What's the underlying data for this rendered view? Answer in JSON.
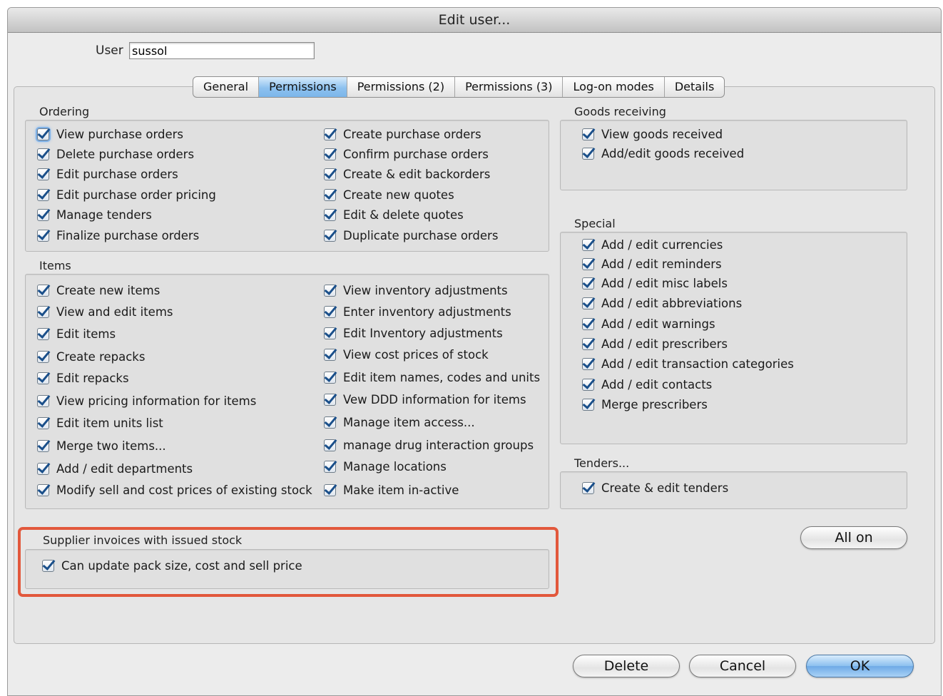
{
  "window": {
    "title": "Edit user..."
  },
  "user": {
    "label": "User",
    "value": "sussol"
  },
  "tabs": [
    {
      "label": "General",
      "active": false
    },
    {
      "label": "Permissions",
      "active": true
    },
    {
      "label": "Permissions (2)",
      "active": false
    },
    {
      "label": "Permissions (3)",
      "active": false
    },
    {
      "label": "Log-on modes",
      "active": false
    },
    {
      "label": "Details",
      "active": false
    }
  ],
  "ordering": {
    "title": "Ordering",
    "left": [
      "View purchase orders",
      "Delete purchase orders",
      "Edit purchase orders",
      "Edit purchase order pricing",
      "Manage tenders",
      "Finalize purchase orders"
    ],
    "right": [
      "Create purchase orders",
      "Confirm purchase orders",
      "Create & edit backorders",
      "Create new quotes",
      "Edit & delete quotes",
      "Duplicate purchase orders"
    ]
  },
  "items": {
    "title": "Items",
    "left": [
      "Create new items",
      "View and edit items",
      "Edit items",
      "Create repacks",
      "Edit repacks",
      "View pricing information for items",
      "Edit item units list",
      "Merge two items...",
      "Add / edit departments",
      "Modify sell and cost prices of existing stock"
    ],
    "right": [
      "View inventory adjustments",
      "Enter inventory adjustments",
      "Edit Inventory adjustments",
      "View cost prices of stock",
      "Edit item names, codes and units",
      "Vew DDD information for items",
      "Manage item access...",
      "manage drug interaction groups",
      "Manage locations",
      "Make item in-active"
    ]
  },
  "supplier": {
    "title": "Supplier invoices with issued stock",
    "items": [
      "Can update pack size, cost and sell price"
    ]
  },
  "goods": {
    "title": "Goods receiving",
    "items": [
      "View goods received",
      "Add/edit goods received"
    ]
  },
  "special": {
    "title": "Special",
    "items": [
      "Add / edit currencies",
      "Add / edit reminders",
      "Add / edit misc labels",
      "Add / edit abbreviations",
      "Add / edit warnings",
      "Add / edit prescribers",
      "Add / edit transaction categories",
      "Add / edit contacts",
      "Merge prescribers"
    ]
  },
  "tenders": {
    "title": "Tenders...",
    "items": [
      "Create & edit tenders"
    ]
  },
  "buttons": {
    "all_on": "All on",
    "delete": "Delete",
    "cancel": "Cancel",
    "ok": "OK"
  },
  "colors": {
    "highlight": "#e2583c",
    "checkmark": "#1a4f8a",
    "active_tab": "#8dc1ef"
  }
}
